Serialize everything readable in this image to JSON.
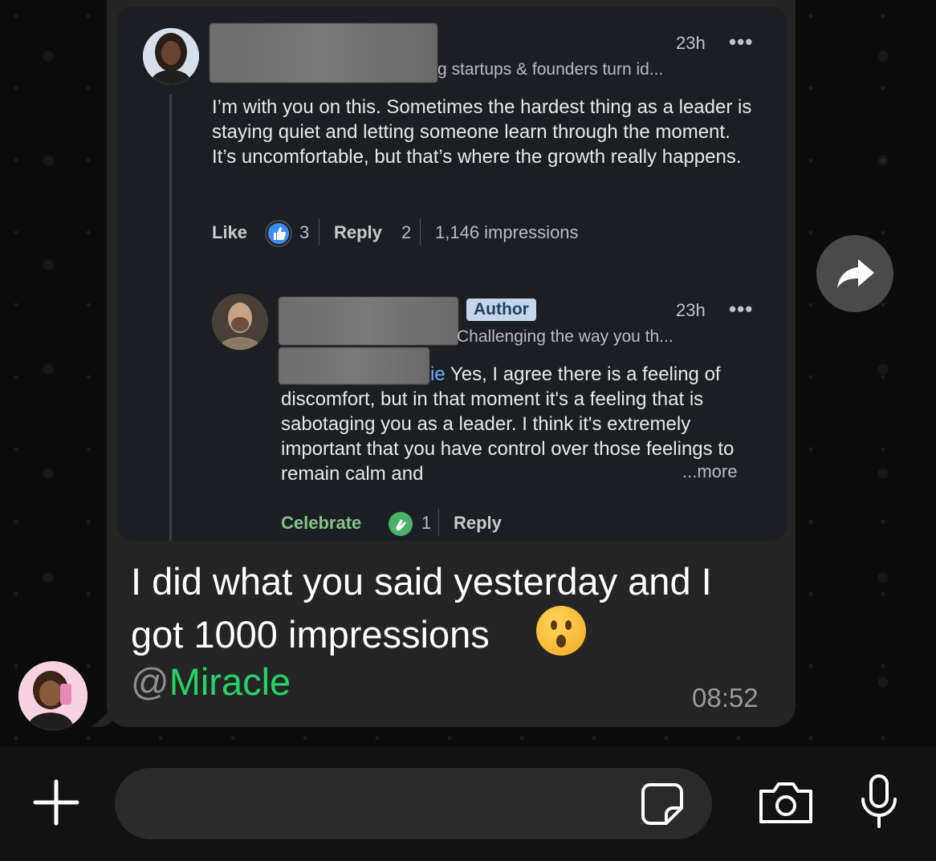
{
  "chat": {
    "message": {
      "text": "I did what you said yesterday and I got 1000 impressions",
      "mention_at": "@",
      "mention_name": "Miracle",
      "time": "08:52"
    },
    "shared_screenshot": {
      "comment1": {
        "headline_visible": "g startups & founders turn id...",
        "time": "23h",
        "more_icon": "•••",
        "text": "I’m with you on this. Sometimes the hardest thing as a leader is staying quiet and letting someone learn through the moment. It’s uncomfortable, but that’s where the growth really happens.",
        "like_label": "Like",
        "like_count": "3",
        "reply_label": "Reply",
        "reply_count": "2",
        "impressions": "1,146 impressions"
      },
      "comment2": {
        "badge": "Author",
        "headline_visible": "Challenging the way you th...",
        "time": "23h",
        "more_icon": "•••",
        "mention_suffix": "ie",
        "text": "Yes, I agree there is a feeling of discomfort, but in that moment it's a feeling that is sabotaging you as a leader. I think it's extremely important that you have control over those feelings to remain calm and",
        "more_label": "...more",
        "celebrate_label": "Celebrate",
        "celebrate_count": "1",
        "reply_label": "Reply"
      }
    }
  },
  "colors": {
    "mention_green": "#25d366",
    "bubble": "#242424",
    "background": "#0b0b0b"
  },
  "icons": {
    "forward": "forward-arrow-icon",
    "plus": "plus-icon",
    "sticker": "sticker-icon",
    "camera": "camera-icon",
    "mic": "microphone-icon"
  }
}
